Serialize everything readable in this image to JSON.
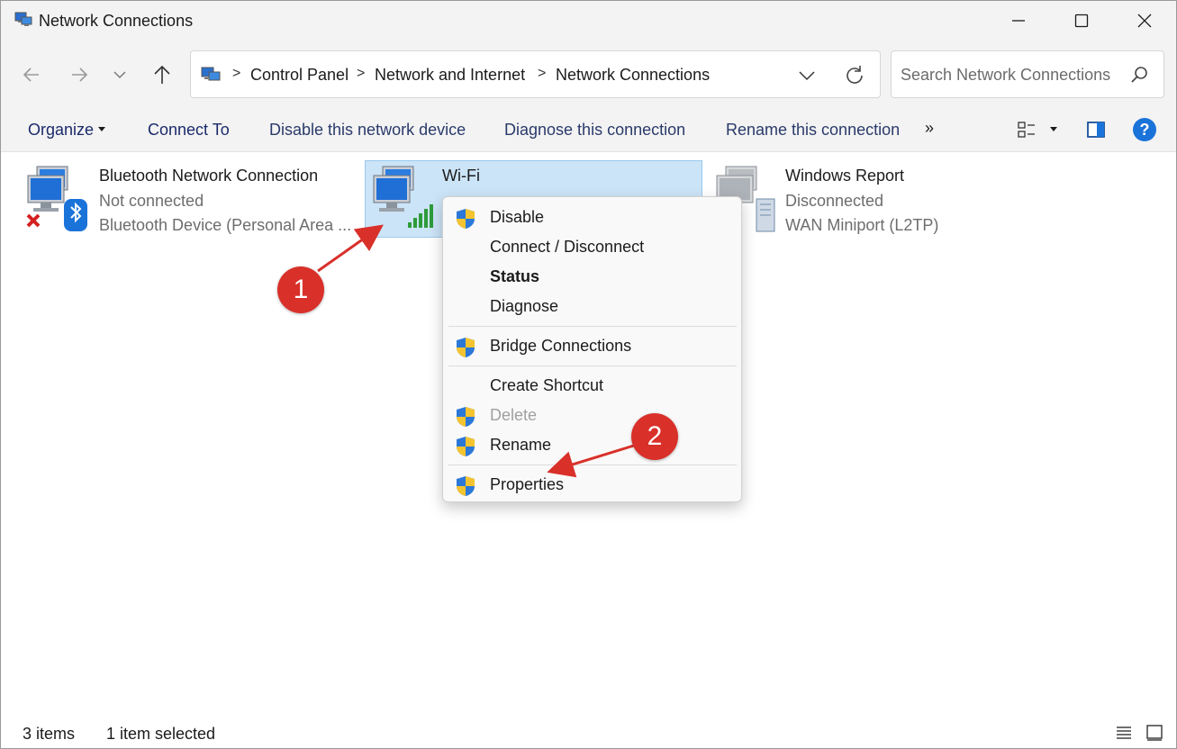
{
  "window": {
    "title": "Network Connections"
  },
  "address": {
    "crumbs": [
      "Control Panel",
      "Network and Internet",
      "Network Connections"
    ],
    "separator": ">",
    "search_placeholder": "Search Network Connections"
  },
  "toolbar": {
    "organize": "Organize",
    "connect_to": "Connect To",
    "disable": "Disable this network device",
    "diagnose": "Diagnose this connection",
    "rename": "Rename this connection",
    "more": "»",
    "help": "?"
  },
  "connections": [
    {
      "name": "Bluetooth Network Connection",
      "status": "Not connected",
      "device": "Bluetooth Device (Personal Area ..."
    },
    {
      "name": "Wi-Fi",
      "status": "",
      "device": ""
    },
    {
      "name": "Windows Report",
      "status": "Disconnected",
      "device": "WAN Miniport (L2TP)"
    }
  ],
  "context_menu": {
    "items": [
      {
        "label": "Disable",
        "shield": true
      },
      {
        "label": "Connect / Disconnect",
        "shield": false
      },
      {
        "label": "Status",
        "shield": false,
        "bold": true
      },
      {
        "label": "Diagnose",
        "shield": false
      },
      {
        "label": "Bridge Connections",
        "shield": true
      },
      {
        "label": "Create Shortcut",
        "shield": false
      },
      {
        "label": "Delete",
        "shield": true,
        "disabled": true
      },
      {
        "label": "Rename",
        "shield": true
      },
      {
        "label": "Properties",
        "shield": true
      }
    ]
  },
  "annotations": {
    "step1": "1",
    "step2": "2"
  },
  "status_bar": {
    "items": "3 items",
    "selected": "1 item selected"
  },
  "colors": {
    "accent": "#1a73d9",
    "selection": "#cce4f7",
    "annotation": "#d9302a"
  }
}
